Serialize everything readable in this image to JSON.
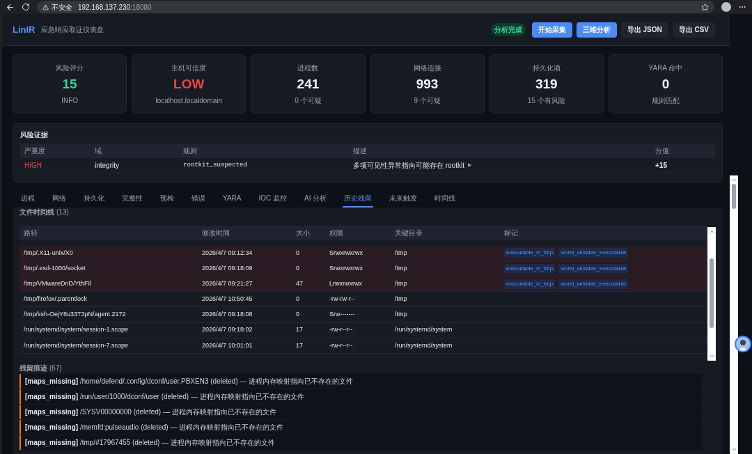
{
  "browser": {
    "security": "不安全",
    "address_host": "192.168.137.230",
    "address_port": ":18080"
  },
  "header": {
    "logo": "LinIR",
    "subtitle": "应急响应取证仪表盘",
    "status": "分析完成",
    "buttons": [
      {
        "label": "开始采集",
        "kind": "primary"
      },
      {
        "label": "三维分析",
        "kind": "primary"
      },
      {
        "label": "导出 JSON",
        "kind": "secondary"
      },
      {
        "label": "导出 CSV",
        "kind": "secondary"
      }
    ]
  },
  "stats": [
    {
      "label": "风险评分",
      "value": "15",
      "color": "#34d399",
      "note": "INFO"
    },
    {
      "label": "主机可信度",
      "value": "LOW",
      "color": "#ef4444",
      "note": "localhost.localdomain"
    },
    {
      "label": "进程数",
      "value": "241",
      "color": "#f3f4f6",
      "note": "0 个可疑"
    },
    {
      "label": "网络连接",
      "value": "993",
      "color": "#f3f4f6",
      "note": "9 个可疑"
    },
    {
      "label": "持久化项",
      "value": "319",
      "color": "#f3f4f6",
      "note": "15 个有风险"
    },
    {
      "label": "YARA 命中",
      "value": "0",
      "color": "#f3f4f6",
      "note": "规则匹配"
    }
  ],
  "evidence": {
    "title": "风险证据",
    "columns": [
      "严重度",
      "域",
      "规则",
      "描述",
      "分值"
    ],
    "rows": [
      {
        "severity": "HIGH",
        "domain": "integrity",
        "rule": "rootkit_suspected",
        "description": "多项可见性异常指向可能存在 rootkit",
        "expand": "▶",
        "score": "+15"
      }
    ]
  },
  "tabs": [
    {
      "label": "进程",
      "selected": false
    },
    {
      "label": "网络",
      "selected": false
    },
    {
      "label": "持久化",
      "selected": false
    },
    {
      "label": "完整性",
      "selected": false
    },
    {
      "label": "预检",
      "selected": false
    },
    {
      "label": "错误",
      "selected": false
    },
    {
      "label": "YARA",
      "selected": false
    },
    {
      "label": "IOC 监控",
      "selected": false
    },
    {
      "label": "AI 分析",
      "selected": false
    },
    {
      "label": "历史残留",
      "selected": true
    },
    {
      "label": "未来触发",
      "selected": false
    },
    {
      "label": "时间线",
      "selected": false
    }
  ],
  "file_timeline": {
    "title": "文件时间线",
    "count": "(13)",
    "columns": [
      "路径",
      "修改时间",
      "大小",
      "权限",
      "关键目录",
      "标记"
    ],
    "rows": [
      {
        "path": "/tmp/.X11-unix/X0",
        "mtime": "2026/4/7 09:12:34",
        "size": "0",
        "perm": "Srwxrwxrwx",
        "dir": "/tmp",
        "flagged": true,
        "tags": [
          "executable_in_tmp",
          "world_writable_executable"
        ]
      },
      {
        "path": "/tmp/.esd-1000/socket",
        "mtime": "2026/4/7 09:18:09",
        "size": "0",
        "perm": "Srwxrwxrwx",
        "dir": "/tmp",
        "flagged": true,
        "tags": [
          "executable_in_tmp",
          "world_writable_executable"
        ]
      },
      {
        "path": "/tmp/VMwareDnD/YthFIl",
        "mtime": "2026/4/7 09:21:27",
        "size": "47",
        "perm": "Lrwxrwxrwx",
        "dir": "/tmp",
        "flagged": true,
        "tags": [
          "executable_in_tmp",
          "world_writable_executable"
        ]
      },
      {
        "path": "/tmp/firefox/.parentlock",
        "mtime": "2026/4/7 10:50:45",
        "size": "0",
        "perm": "-rw-rw-r--",
        "dir": "/tmp",
        "flagged": false,
        "tags": []
      },
      {
        "path": "/tmp/ssh-OejY8u33T3pN/agent.2172",
        "mtime": "2026/4/7 09:18:08",
        "size": "0",
        "perm": "Srw-------",
        "dir": "/tmp",
        "flagged": false,
        "tags": []
      },
      {
        "path": "/run/systemd/system/session-1.scope",
        "mtime": "2026/4/7 09:18:02",
        "size": "17",
        "perm": "-rw-r--r--",
        "dir": "/run/systemd/system",
        "flagged": false,
        "tags": []
      },
      {
        "path": "/run/systemd/system/session-7.scope",
        "mtime": "2026/4/7 10:01:01",
        "size": "17",
        "perm": "-rw-r--r--",
        "dir": "/run/systemd/system",
        "flagged": false,
        "tags": []
      }
    ]
  },
  "residue": {
    "title": "残留痕迹",
    "count": "(67)",
    "items": [
      {
        "kind": "[maps_missing]",
        "text": "/home/defend/.config/dconf/user.PBXEN3 (deleted) — 进程内存映射指向已不存在的文件"
      },
      {
        "kind": "[maps_missing]",
        "text": "/run/user/1000/dconf/user (deleted) — 进程内存映射指向已不存在的文件"
      },
      {
        "kind": "[maps_missing]",
        "text": "/SYSV00000000 (deleted) — 进程内存映射指向已不存在的文件"
      },
      {
        "kind": "[maps_missing]",
        "text": "/memfd:pulseaudio (deleted) — 进程内存映射指向已不存在的文件"
      },
      {
        "kind": "[maps_missing]",
        "text": "/tmp/#17967455 (deleted) — 进程内存映射指向已不存在的文件"
      }
    ]
  }
}
